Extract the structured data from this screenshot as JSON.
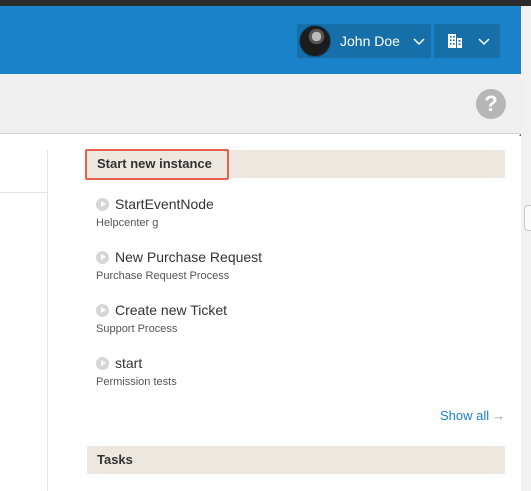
{
  "header": {
    "user_name": "John Doe",
    "brand_color": "#1a82c8",
    "icons": [
      "avatar",
      "chevron-down-icon",
      "building-icon",
      "chevron-down-icon"
    ]
  },
  "toolbar": {
    "help_label": "?"
  },
  "start_new_instance": {
    "title": "Start new instance",
    "items": [
      {
        "name": "StartEventNode",
        "process": "Helpcenter g"
      },
      {
        "name": "New Purchase Request",
        "process": "Purchase Request Process"
      },
      {
        "name": "Create new Ticket",
        "process": "Support Process"
      },
      {
        "name": "start",
        "process": "Permission tests"
      }
    ],
    "show_all": "Show all",
    "show_all_arrow": "→"
  },
  "tasks": {
    "title": "Tasks"
  }
}
